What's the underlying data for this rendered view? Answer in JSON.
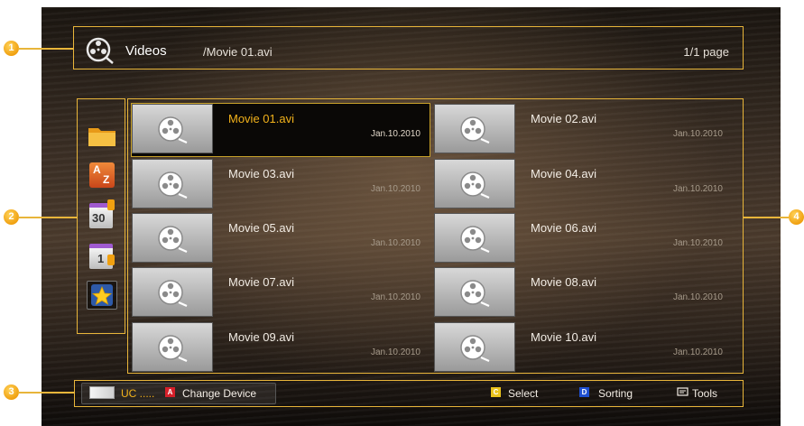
{
  "header": {
    "title": "Videos",
    "path": "/Movie 01.avi",
    "page": "1/1 page"
  },
  "callouts": [
    "1",
    "2",
    "3",
    "4"
  ],
  "sidebar": {
    "items": [
      {
        "icon": "folder-icon"
      },
      {
        "icon": "sort-az-icon",
        "text": "A",
        "text2": "Z"
      },
      {
        "icon": "calendar-30-icon",
        "text": "30"
      },
      {
        "icon": "calendar-1-icon",
        "text": "1"
      },
      {
        "icon": "star-favorite-icon",
        "active": true
      }
    ]
  },
  "files": [
    {
      "name": "Movie 01.avi",
      "date": "Jan.10.2010",
      "selected": true
    },
    {
      "name": "Movie 02.avi",
      "date": "Jan.10.2010"
    },
    {
      "name": "Movie 03.avi",
      "date": "Jan.10.2010"
    },
    {
      "name": "Movie 04.avi",
      "date": "Jan.10.2010"
    },
    {
      "name": "Movie 05.avi",
      "date": "Jan.10.2010"
    },
    {
      "name": "Movie 06.avi",
      "date": "Jan.10.2010"
    },
    {
      "name": "Movie 07.avi",
      "date": "Jan.10.2010"
    },
    {
      "name": "Movie 08.avi",
      "date": "Jan.10.2010"
    },
    {
      "name": "Movie 09.avi",
      "date": "Jan.10.2010"
    },
    {
      "name": "Movie 10.avi",
      "date": "Jan.10.2010"
    }
  ],
  "footer": {
    "device": "UC .....",
    "change_device": {
      "key": "A",
      "label": "Change Device"
    },
    "select": {
      "key": "C",
      "label": "Select"
    },
    "sorting": {
      "key": "D",
      "label": "Sorting"
    },
    "tools": {
      "label": "Tools"
    }
  },
  "colors": {
    "accent": "#e8b53a",
    "key_a": "#d6202a",
    "key_c": "#e9c21c",
    "key_d": "#1f4fd0"
  }
}
